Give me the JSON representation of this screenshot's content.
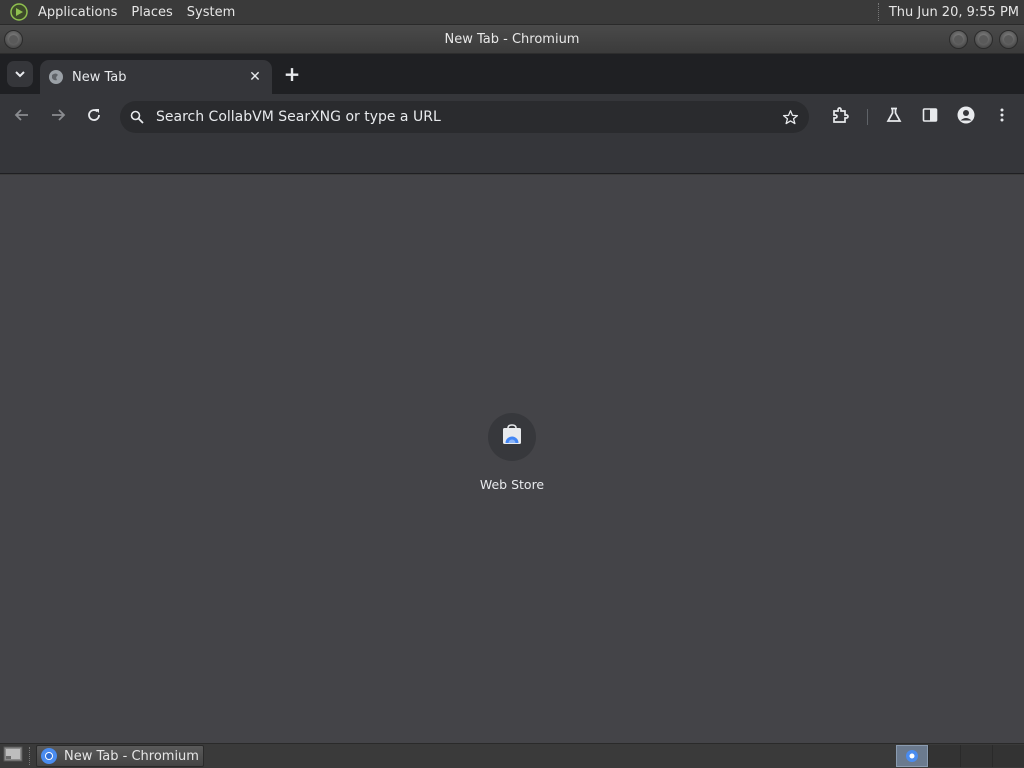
{
  "top_panel": {
    "menus": [
      "Applications",
      "Places",
      "System"
    ],
    "clock": "Thu Jun 20,  9:55 PM",
    "apps_icon": "mate-logo-icon"
  },
  "window": {
    "title": "New Tab - Chromium"
  },
  "browser": {
    "tab_search_icon": "chevron-down-icon",
    "tabs": [
      {
        "title": "New Tab",
        "favicon": "globe-icon",
        "active": true
      }
    ],
    "tab_close_glyph": "✕",
    "new_tab_glyph": "+",
    "omnibox": {
      "placeholder": "Search CollabVM SearXNG or type a URL",
      "value": ""
    },
    "toolbar_icons": [
      "back-icon",
      "forward-icon",
      "reload-icon",
      "star-icon",
      "extensions-icon",
      "labs-icon",
      "side-panel-icon",
      "profile-icon",
      "menu-icon"
    ]
  },
  "new_tab_page": {
    "shortcuts": [
      {
        "label": "Web Store",
        "icon": "web-store-icon"
      }
    ]
  },
  "taskbar": {
    "tasks": [
      {
        "label": "New Tab - Chromium",
        "icon": "chromium-icon",
        "active": true
      }
    ],
    "workspaces": 4,
    "active_workspace": 1
  },
  "colors": {
    "tabstrip_bg": "#1f2023",
    "toolbar_bg": "#35363a",
    "content_bg": "#444448",
    "text": "#e8eaed"
  }
}
